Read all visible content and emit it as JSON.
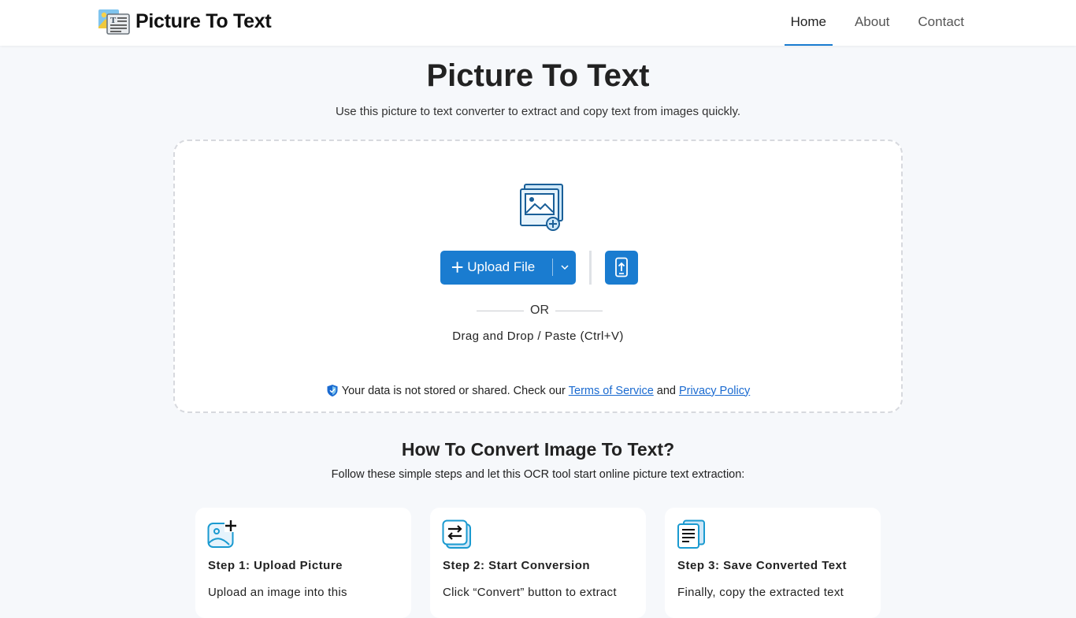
{
  "brand": {
    "name": "Picture To Text",
    "icon": "picture-to-text-logo-icon"
  },
  "nav": {
    "items": [
      {
        "label": "Home",
        "active": true
      },
      {
        "label": "About",
        "active": false
      },
      {
        "label": "Contact",
        "active": false
      }
    ]
  },
  "hero": {
    "title": "Picture To Text",
    "subtitle": "Use this picture to text converter to extract and copy text from images quickly."
  },
  "upload": {
    "illustration_icon": "image-add-icon",
    "button_label": "Upload File",
    "mobile_icon": "mobile-upload-icon",
    "or_text": "OR",
    "drag_text": "Drag and Drop / Paste (Ctrl+V)",
    "privacy_prefix": "Your data is not stored or shared. Check our",
    "terms_link": "Terms of Service",
    "and_text": "and",
    "privacy_link": "Privacy Policy"
  },
  "how": {
    "title": "How To Convert Image To Text?",
    "subtitle": "Follow these simple steps and let this OCR tool start online picture text extraction:",
    "steps": [
      {
        "title": "Step 1: Upload Picture",
        "desc": "Upload an image into this",
        "icon": "upload-picture-icon"
      },
      {
        "title": "Step 2: Start Conversion",
        "desc": "Click “Convert” button to extract",
        "icon": "convert-icon"
      },
      {
        "title": "Step 3: Save Converted Text",
        "desc": "Finally, copy the extracted text",
        "icon": "save-text-icon"
      }
    ]
  },
  "colors": {
    "accent": "#1a7cd0",
    "link": "#1a6ad0",
    "background": "#f6f8fb"
  }
}
